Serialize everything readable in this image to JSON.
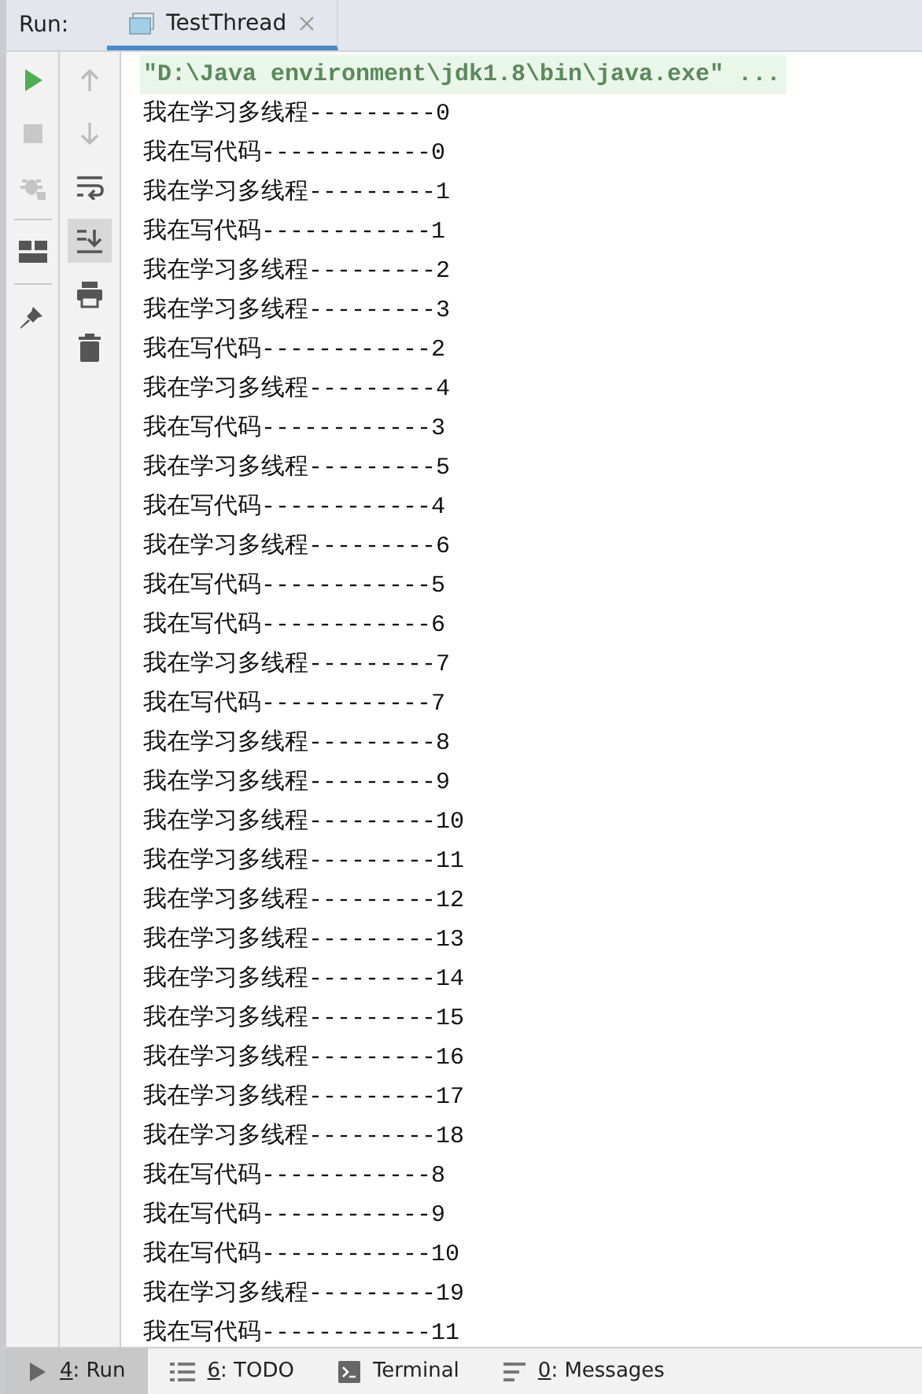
{
  "run_panel": {
    "label": "Run:",
    "tabs": [
      {
        "title": "TestThread",
        "selected": true
      }
    ]
  },
  "toolbar_left": [
    {
      "kind": "run",
      "disabled": false
    },
    {
      "kind": "stop",
      "disabled": true
    },
    {
      "kind": "debug",
      "disabled": true
    },
    {
      "kind": "separator"
    },
    {
      "kind": "layout",
      "disabled": false
    },
    {
      "kind": "separator"
    },
    {
      "kind": "pin",
      "disabled": false
    }
  ],
  "toolbar_right": [
    {
      "kind": "up",
      "disabled": true,
      "selected": false
    },
    {
      "kind": "down",
      "disabled": true,
      "selected": false
    },
    {
      "kind": "wrap",
      "disabled": false,
      "selected": false
    },
    {
      "kind": "scroll-end",
      "disabled": false,
      "selected": true
    },
    {
      "kind": "print",
      "disabled": false,
      "selected": false
    },
    {
      "kind": "trash",
      "disabled": false,
      "selected": false
    }
  ],
  "console": {
    "command": "\"D:\\Java environment\\jdk1.8\\bin\\java.exe\" ...",
    "lines": [
      "我在学习多线程---------0",
      "我在写代码------------0",
      "我在学习多线程---------1",
      "我在写代码------------1",
      "我在学习多线程---------2",
      "我在学习多线程---------3",
      "我在写代码------------2",
      "我在学习多线程---------4",
      "我在写代码------------3",
      "我在学习多线程---------5",
      "我在写代码------------4",
      "我在学习多线程---------6",
      "我在写代码------------5",
      "我在写代码------------6",
      "我在学习多线程---------7",
      "我在写代码------------7",
      "我在学习多线程---------8",
      "我在学习多线程---------9",
      "我在学习多线程---------10",
      "我在学习多线程---------11",
      "我在学习多线程---------12",
      "我在学习多线程---------13",
      "我在学习多线程---------14",
      "我在学习多线程---------15",
      "我在学习多线程---------16",
      "我在学习多线程---------17",
      "我在学习多线程---------18",
      "我在写代码------------8",
      "我在写代码------------9",
      "我在写代码------------10",
      "我在学习多线程---------19",
      "我在写代码------------11"
    ]
  },
  "bottom_tabs": [
    {
      "kind": "run",
      "mnemonic": "4",
      "label": ": Run",
      "selected": true
    },
    {
      "kind": "todo",
      "mnemonic": "6",
      "label": ": TODO",
      "selected": false
    },
    {
      "kind": "terminal",
      "label": "Terminal",
      "selected": false
    },
    {
      "kind": "messages",
      "mnemonic": "0",
      "label": ": Messages",
      "selected": false
    }
  ]
}
